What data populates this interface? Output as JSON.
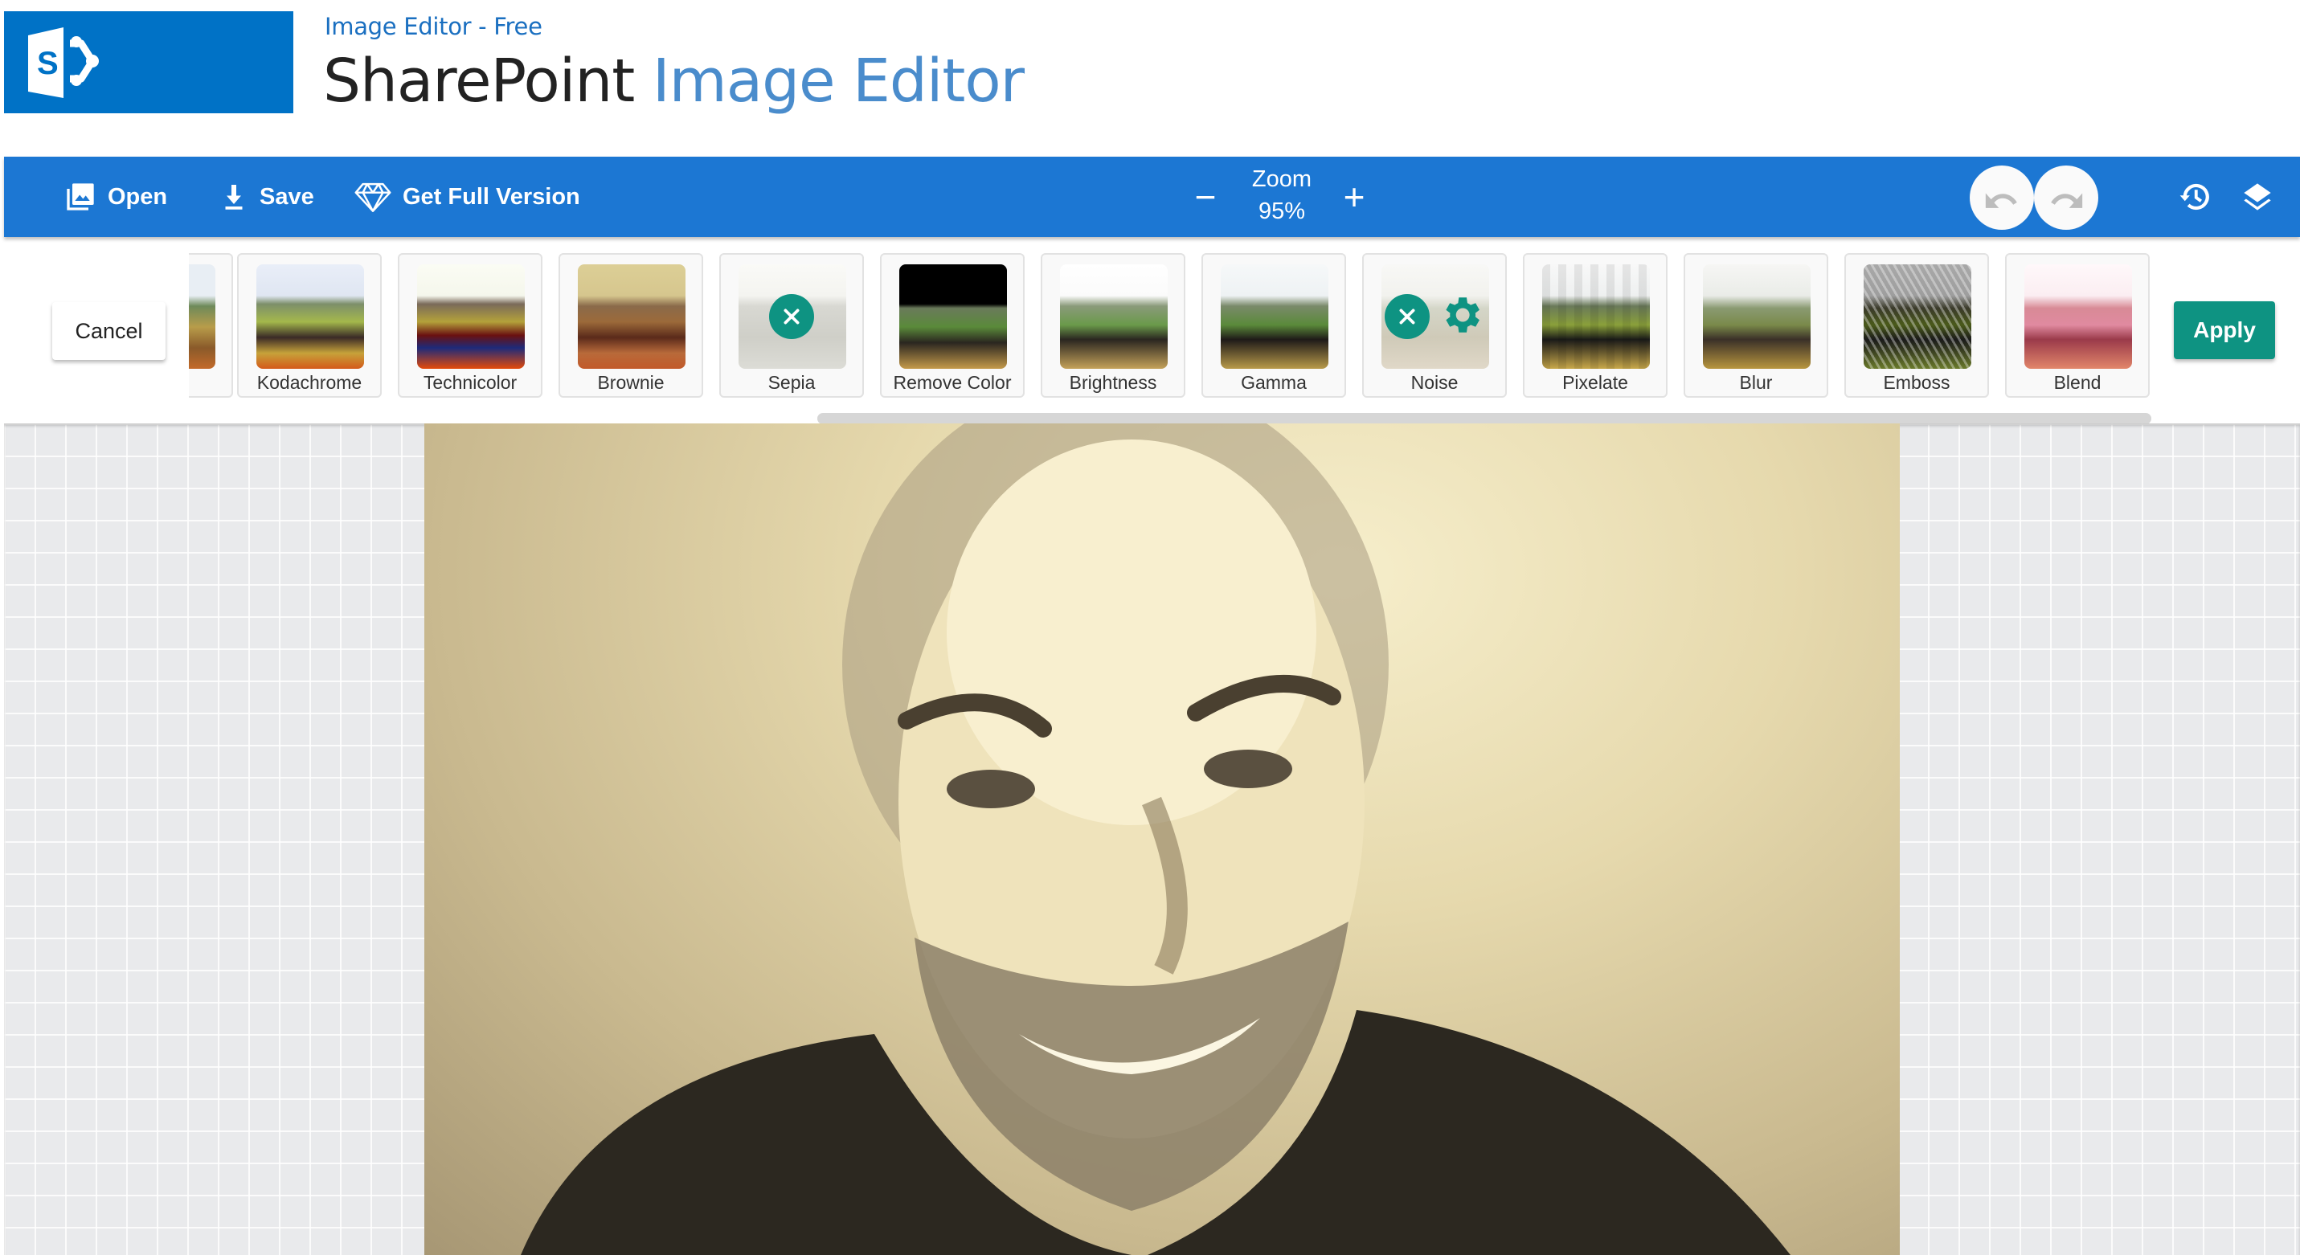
{
  "header": {
    "subtitle": "Image Editor - Free",
    "title_main": "SharePoint",
    "title_accent": "Image Editor",
    "logo_letter": "S"
  },
  "toolbar": {
    "open_label": "Open",
    "save_label": "Save",
    "full_version_label": "Get Full Version",
    "zoom_label": "Zoom",
    "zoom_value": "95%",
    "zoom_minus": "−",
    "zoom_plus": "+",
    "icons": [
      "image-icon",
      "download-icon",
      "diamond-icon",
      "undo-icon",
      "redo-icon",
      "history-icon",
      "layers-icon"
    ]
  },
  "actions": {
    "cancel_label": "Cancel",
    "apply_label": "Apply"
  },
  "filters": [
    {
      "label": "",
      "partial": true
    },
    {
      "label": "Kodachrome"
    },
    {
      "label": "Technicolor"
    },
    {
      "label": "Brownie"
    },
    {
      "label": "Sepia",
      "state": "applied-removable"
    },
    {
      "label": "Remove Color"
    },
    {
      "label": "Brightness"
    },
    {
      "label": "Gamma"
    },
    {
      "label": "Noise",
      "state": "applied-configurable"
    },
    {
      "label": "Pixelate"
    },
    {
      "label": "Blur"
    },
    {
      "label": "Emboss"
    },
    {
      "label": "Blend"
    }
  ],
  "colors": {
    "brand_blue": "#0072c6",
    "toolbar_blue": "#1c77d3",
    "accent_teal": "#0e9382",
    "title_accent": "#4a8ccc"
  }
}
